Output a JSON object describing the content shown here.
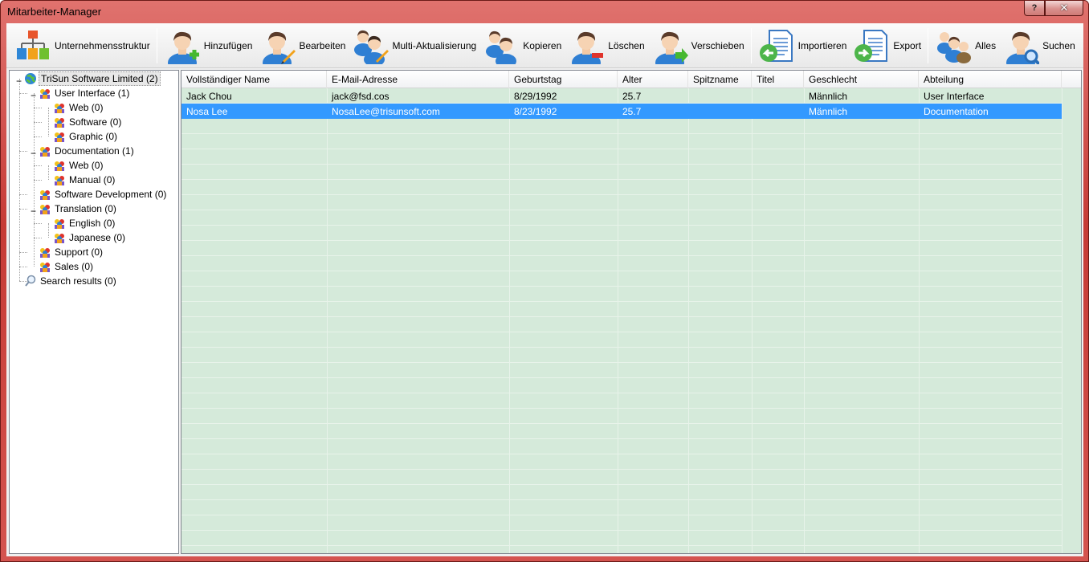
{
  "window": {
    "title": "Mitarbeiter-Manager",
    "help_glyph": "?",
    "close_glyph": "✕"
  },
  "toolbar": {
    "buttons": [
      {
        "label": "Unternehmensstruktur",
        "icon": "org-chart-icon"
      },
      {
        "label": "Hinzufügen",
        "icon": "add-user-icon"
      },
      {
        "label": "Bearbeiten",
        "icon": "edit-user-icon"
      },
      {
        "label": "Multi-Aktualisierung",
        "icon": "multi-update-users-icon"
      },
      {
        "label": "Kopieren",
        "icon": "copy-user-icon"
      },
      {
        "label": "Löschen",
        "icon": "delete-user-icon"
      },
      {
        "label": "Verschieben",
        "icon": "move-user-icon"
      },
      {
        "label": "Importieren",
        "icon": "import-icon"
      },
      {
        "label": "Export",
        "icon": "export-icon"
      },
      {
        "label": "Alles",
        "icon": "all-users-icon"
      },
      {
        "label": "Suchen",
        "icon": "search-user-icon"
      }
    ]
  },
  "tree": {
    "items": [
      {
        "label": "TriSun Software Limited (2)",
        "icon": "globe-icon",
        "level": 0,
        "expander": "−"
      },
      {
        "label": "User Interface (1)",
        "icon": "department-icon",
        "level": 1,
        "expander": "−"
      },
      {
        "label": "Web (0)",
        "icon": "department-icon",
        "level": 2
      },
      {
        "label": "Software (0)",
        "icon": "department-icon",
        "level": 2
      },
      {
        "label": "Graphic (0)",
        "icon": "department-icon",
        "level": 2
      },
      {
        "label": "Documentation (1)",
        "icon": "department-icon",
        "level": 1,
        "expander": "−"
      },
      {
        "label": "Web (0)",
        "icon": "department-icon",
        "level": 2
      },
      {
        "label": "Manual (0)",
        "icon": "department-icon",
        "level": 2
      },
      {
        "label": "Software Development (0)",
        "icon": "department-icon",
        "level": 1
      },
      {
        "label": "Translation (0)",
        "icon": "department-icon",
        "level": 1,
        "expander": "−"
      },
      {
        "label": "English (0)",
        "icon": "department-icon",
        "level": 2
      },
      {
        "label": "Japanese (0)",
        "icon": "department-icon",
        "level": 2
      },
      {
        "label": "Support (0)",
        "icon": "department-icon",
        "level": 1
      },
      {
        "label": "Sales (0)",
        "icon": "department-icon",
        "level": 1
      },
      {
        "label": "Search results (0)",
        "icon": "magnifier-icon",
        "level": 0
      }
    ]
  },
  "grid": {
    "columns": [
      "Vollständiger Name",
      "E-Mail-Adresse",
      "Geburtstag",
      "Alter",
      "Spitzname",
      "Titel",
      "Geschlecht",
      "Abteilung"
    ],
    "rows": [
      [
        "Jack Chou",
        "jack@fsd.cos",
        "8/29/1992",
        "25.7",
        "",
        "",
        "Männlich",
        "User Interface"
      ],
      [
        "Nosa Lee",
        "NosaLee@trisunsoft.com",
        "8/23/1992",
        "25.7",
        "",
        "",
        "Männlich",
        "Documentation"
      ]
    ],
    "selected_row": 1
  },
  "colors": {
    "titlebar": "#c63b36",
    "grid_background": "#d5eada",
    "selection": "#3399ff"
  }
}
